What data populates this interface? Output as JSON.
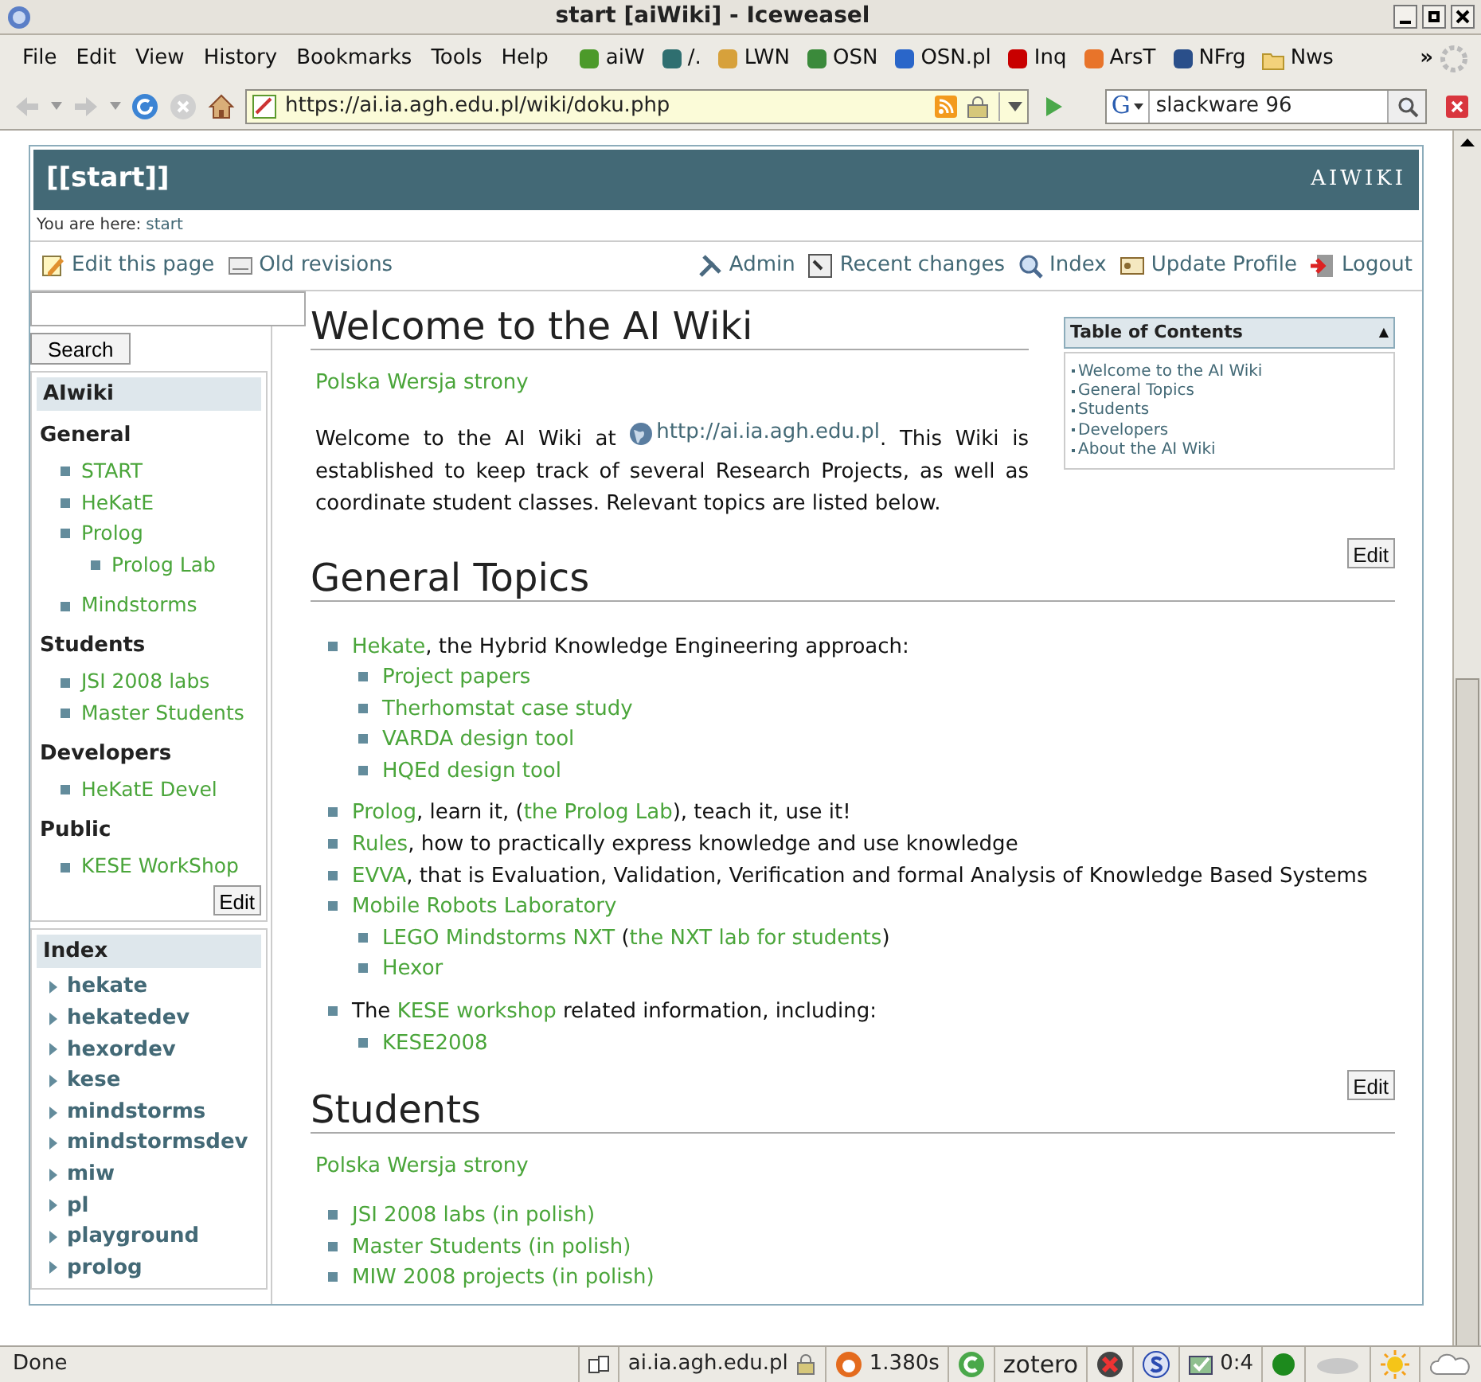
{
  "window": {
    "title": "start [aiWiki] - Iceweasel"
  },
  "menu": [
    "File",
    "Edit",
    "View",
    "History",
    "Bookmarks",
    "Tools",
    "Help"
  ],
  "bookmarks": [
    {
      "label": "aiW",
      "kind": "site"
    },
    {
      "label": "/.",
      "kind": "site"
    },
    {
      "label": "LWN",
      "kind": "site"
    },
    {
      "label": "OSN",
      "kind": "site"
    },
    {
      "label": "OSN.pl",
      "kind": "site"
    },
    {
      "label": "Inq",
      "kind": "site"
    },
    {
      "label": "ArsT",
      "kind": "site"
    },
    {
      "label": "NFrg",
      "kind": "site"
    },
    {
      "label": "Nws",
      "kind": "folder"
    }
  ],
  "bookmarks_overflow": "»",
  "navigation": {
    "url": "https://ai.ia.agh.edu.pl/wiki/doku.php",
    "search_engine": "G",
    "search_value": "slackware 96"
  },
  "wiki": {
    "page_title": "[[start]]",
    "logo": "AIWIKI",
    "breadcrumb_label": "You are here:",
    "breadcrumb_link": "start",
    "actions_left": [
      {
        "label": "Edit this page"
      },
      {
        "label": "Old revisions"
      }
    ],
    "actions_right": [
      {
        "label": "Admin"
      },
      {
        "label": "Recent changes"
      },
      {
        "label": "Index"
      },
      {
        "label": "Update Profile"
      },
      {
        "label": "Logout"
      }
    ]
  },
  "sidebar": {
    "search_button": "Search",
    "menu_box": {
      "title": "AIwiki",
      "edit_button": "Edit",
      "groups": [
        {
          "title": "General",
          "items": [
            {
              "label": "START"
            },
            {
              "label": "HeKatE"
            },
            {
              "label": "Prolog",
              "children": [
                {
                  "label": "Prolog Lab"
                }
              ]
            },
            {
              "label": "Mindstorms"
            }
          ]
        },
        {
          "title": "Students",
          "items": [
            {
              "label": "JSI 2008 labs"
            },
            {
              "label": "Master Students"
            }
          ]
        },
        {
          "title": "Developers",
          "items": [
            {
              "label": "HeKatE Devel"
            }
          ]
        },
        {
          "title": "Public",
          "items": [
            {
              "label": "KESE WorkShop"
            }
          ]
        }
      ]
    },
    "index_box": {
      "title": "Index",
      "items": [
        "hekate",
        "hekatedev",
        "hexordev",
        "kese",
        "mindstorms",
        "mindstormsdev",
        "miw",
        "pl",
        "playground",
        "prolog"
      ]
    }
  },
  "toc": {
    "title": "Table of Contents",
    "toggle": "▲",
    "items": [
      "Welcome to the AI Wiki",
      "General Topics",
      "Students",
      "Developers",
      "About the AI Wiki"
    ]
  },
  "sections": [
    {
      "heading": "Welcome to the AI Wiki",
      "edit_button": "Edit",
      "blocks": [
        {
          "kind": "para",
          "segments": [
            {
              "kind": "link",
              "text": "Polska Wersja strony"
            }
          ]
        },
        {
          "kind": "para",
          "segments": [
            {
              "kind": "text",
              "text": "Welcome to the AI Wiki at "
            },
            {
              "kind": "external",
              "text": "http://ai.ia.agh.edu.pl"
            },
            {
              "kind": "text",
              "text": ". This Wiki is established to keep track of several Research Projects, as well as coordinate student classes. Relevant topics are listed below."
            }
          ]
        }
      ]
    },
    {
      "heading": "General Topics",
      "edit_button": "Edit",
      "blocks": [
        {
          "kind": "list",
          "items": [
            {
              "segments": [
                {
                  "kind": "link",
                  "text": "Hekate"
                },
                {
                  "kind": "text",
                  "text": ", the Hybrid Knowledge Engineering approach:"
                }
              ],
              "children": [
                {
                  "segments": [
                    {
                      "kind": "link",
                      "text": "Project papers"
                    }
                  ]
                },
                {
                  "segments": [
                    {
                      "kind": "link",
                      "text": "Therhomstat case study"
                    }
                  ]
                },
                {
                  "segments": [
                    {
                      "kind": "link",
                      "text": "VARDA design tool"
                    }
                  ]
                },
                {
                  "segments": [
                    {
                      "kind": "link",
                      "text": "HQEd design tool"
                    }
                  ]
                }
              ]
            },
            {
              "segments": [
                {
                  "kind": "link",
                  "text": "Prolog"
                },
                {
                  "kind": "text",
                  "text": ", learn it, ("
                },
                {
                  "kind": "link",
                  "text": "the Prolog Lab"
                },
                {
                  "kind": "text",
                  "text": "), teach it, use it!"
                }
              ]
            },
            {
              "segments": [
                {
                  "kind": "link",
                  "text": "Rules"
                },
                {
                  "kind": "text",
                  "text": ", how to practically express knowledge and use knowledge"
                }
              ]
            },
            {
              "segments": [
                {
                  "kind": "link",
                  "text": "EVVA"
                },
                {
                  "kind": "text",
                  "text": ", that is Evaluation, Validation, Verification and formal Analysis of Knowledge Based Systems"
                }
              ]
            },
            {
              "segments": [
                {
                  "kind": "link",
                  "text": "Mobile Robots Laboratory"
                }
              ],
              "children": [
                {
                  "segments": [
                    {
                      "kind": "link",
                      "text": "LEGO Mindstorms NXT"
                    },
                    {
                      "kind": "text",
                      "text": " ("
                    },
                    {
                      "kind": "link",
                      "text": "the NXT lab for students"
                    },
                    {
                      "kind": "text",
                      "text": ")"
                    }
                  ]
                },
                {
                  "segments": [
                    {
                      "kind": "link",
                      "text": "Hexor"
                    }
                  ]
                }
              ]
            },
            {
              "segments": [
                {
                  "kind": "text",
                  "text": "The "
                },
                {
                  "kind": "link",
                  "text": "KESE workshop"
                },
                {
                  "kind": "text",
                  "text": " related information, including:"
                }
              ],
              "children": [
                {
                  "segments": [
                    {
                      "kind": "link",
                      "text": "KESE2008"
                    }
                  ]
                }
              ]
            }
          ]
        }
      ]
    },
    {
      "heading": "Students",
      "blocks": [
        {
          "kind": "para",
          "segments": [
            {
              "kind": "link",
              "text": "Polska Wersja strony"
            }
          ]
        },
        {
          "kind": "list",
          "items": [
            {
              "segments": [
                {
                  "kind": "link",
                  "text": "JSI 2008 labs (in polish)"
                }
              ]
            },
            {
              "segments": [
                {
                  "kind": "link",
                  "text": "Master Students (in polish)"
                }
              ]
            },
            {
              "segments": [
                {
                  "kind": "link",
                  "text": "MIW 2008 projects (in polish)"
                }
              ]
            }
          ]
        }
      ]
    }
  ],
  "status_bar": {
    "message": "Done",
    "host": "ai.ia.agh.edu.pl",
    "timing": "1.380s",
    "zotero": "zotero",
    "count": "0:4"
  }
}
